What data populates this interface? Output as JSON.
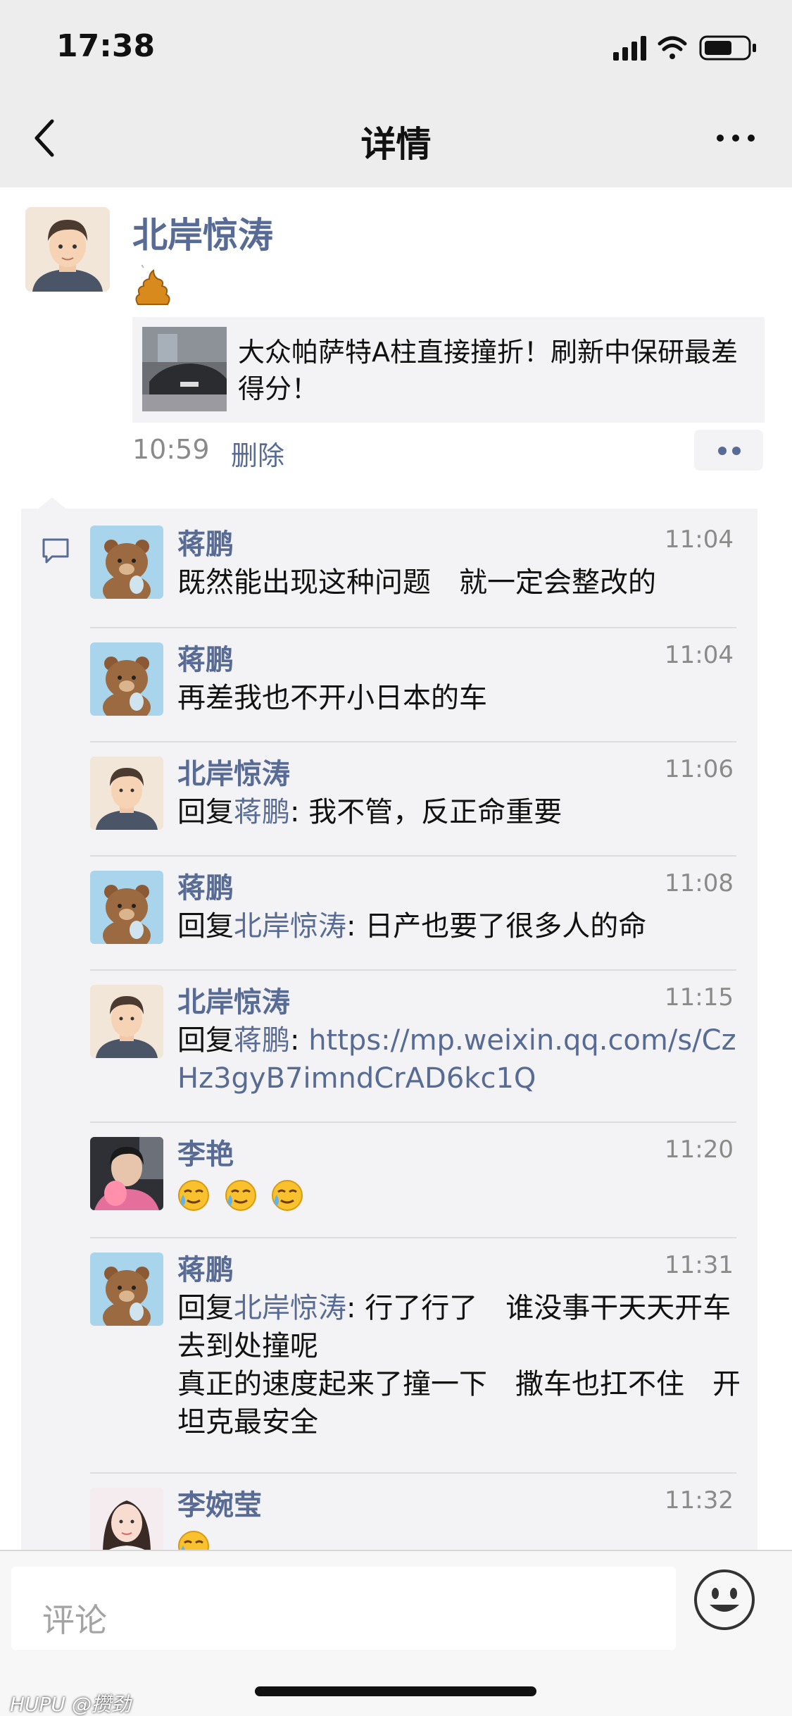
{
  "status": {
    "time": "17:38"
  },
  "nav": {
    "title": "详情"
  },
  "post": {
    "author": "北岸惊涛",
    "link_title": "大众帕萨特A柱直接撞折！刷新中保研最差得分！",
    "time": "10:59",
    "delete_label": "删除"
  },
  "comments": [
    {
      "name": "蒋鹏",
      "time": "11:04",
      "text": "既然能出现这种问题　就一定会整改的"
    },
    {
      "name": "蒋鹏",
      "time": "11:04",
      "text": "再差我也不开小日本的车"
    },
    {
      "name": "北岸惊涛",
      "time": "11:06",
      "reply_prefix": "回复",
      "reply_to": "蒋鹏",
      "text": ": 我不管，反正命重要"
    },
    {
      "name": "蒋鹏",
      "time": "11:08",
      "reply_prefix": "回复",
      "reply_to": "北岸惊涛",
      "text": ": 日产也要了很多人的命"
    },
    {
      "name": "北岸惊涛",
      "time": "11:15",
      "reply_prefix": "回复",
      "reply_to": "蒋鹏",
      "text": ": ",
      "link": "https://mp.weixin.qq.com/s/CzHz3gyB7imndCrAD6kc1Q"
    },
    {
      "name": "李艳",
      "time": "11:20",
      "emoji_count": 3
    },
    {
      "name": "蒋鹏",
      "time": "11:31",
      "reply_prefix": "回复",
      "reply_to": "北岸惊涛",
      "text": ": 行了行了　谁没事干天天开车去到处撞呢",
      "text2": "真正的速度起来了撞一下　撒车也扛不住　开坦克最安全"
    },
    {
      "name": "李婉莹",
      "time": "11:32",
      "emoji_count": 1
    }
  ],
  "input": {
    "placeholder": "评论"
  },
  "watermark": "HUPU @攒劲"
}
